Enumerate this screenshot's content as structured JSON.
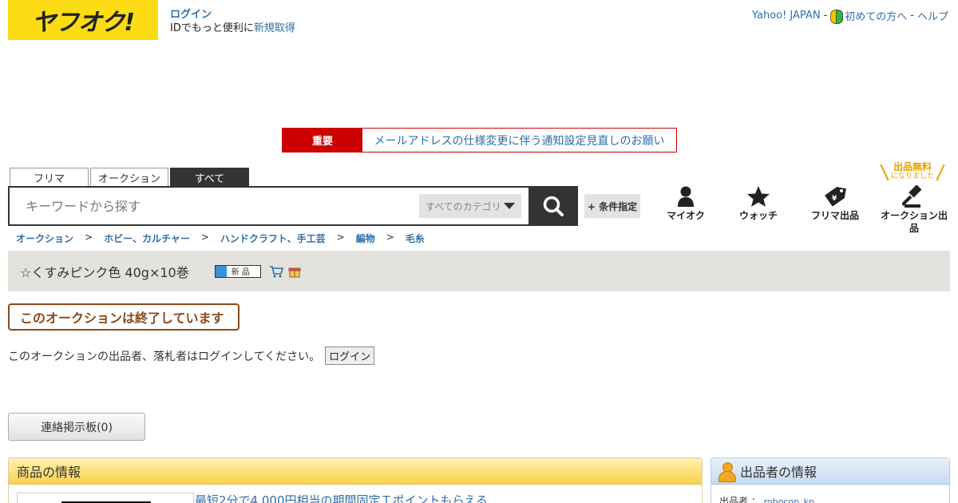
{
  "header": {
    "logo_text": "ヤフオク!",
    "login_link": "ログイン",
    "login_line_prefix": "IDでもっと便利に",
    "register_link": "新規取得",
    "links": {
      "yahoo_japan": "Yahoo! JAPAN",
      "sep": "-",
      "beginners": "初めての方へ",
      "help": "ヘルプ"
    }
  },
  "notice": {
    "tag": "重要",
    "message": "メールアドレスの仕様変更に伴う通知設定見直しのお願い"
  },
  "search": {
    "tabs": [
      "フリマ",
      "オークション",
      "すべて"
    ],
    "active_tab": "すべて",
    "placeholder": "キーワードから探す",
    "category": "すべてのカテゴリ",
    "condition_button": "+ 条件指定"
  },
  "nav": {
    "my_auction": "マイオク",
    "watch": "ウォッチ",
    "flea_listing": "フリマ出品",
    "auction_listing": "オークション出品",
    "free_badge_line1": "出品無料",
    "free_badge_line2": "になりました"
  },
  "breadcrumb": [
    "オークション",
    "ホビー、カルチャー",
    "ハンドクラフト、手工芸",
    "編物",
    "毛糸"
  ],
  "breadcrumb_sep": ">",
  "item": {
    "title": "☆くすみピンク色 40g×10巻",
    "badge_new": "新 品"
  },
  "status": {
    "ended": "このオークションは終了しています",
    "login_prompt": "このオークションの出品者、落札者はログインしてください。",
    "login_button": "ログイン",
    "board_button": "連絡掲示板(0)"
  },
  "product_panel": {
    "heading": "商品の情報",
    "promo_text": "最短2分で4,000円相当の期間固定Ｔポイントもらえる"
  },
  "seller_panel": {
    "heading": "出品者の情報",
    "seller_label": "出品者 ：",
    "seller_id": "robocop_kp"
  }
}
